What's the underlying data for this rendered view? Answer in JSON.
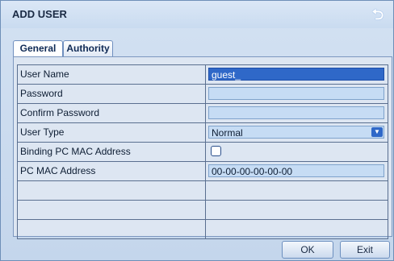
{
  "window": {
    "title": "ADD USER",
    "back_icon": "back-arrow-icon"
  },
  "tabs": [
    {
      "label": "General",
      "active": true
    },
    {
      "label": "Authority",
      "active": false
    }
  ],
  "form": {
    "rows": [
      {
        "label": "User Name",
        "value": "guest_",
        "type": "text",
        "active": true
      },
      {
        "label": "Password",
        "value": "",
        "type": "password"
      },
      {
        "label": "Confirm Password",
        "value": "",
        "type": "password"
      },
      {
        "label": "User Type",
        "value": "Normal",
        "type": "select"
      },
      {
        "label": "Binding PC MAC Address",
        "checked": false,
        "type": "checkbox"
      },
      {
        "label": "PC MAC Address",
        "value": "00-00-00-00-00-00",
        "type": "text"
      }
    ]
  },
  "buttons": {
    "ok": "OK",
    "exit": "Exit"
  },
  "colors": {
    "accent": "#2f68c8",
    "field": "#c6dcf4",
    "panel": "#dde6f2"
  }
}
